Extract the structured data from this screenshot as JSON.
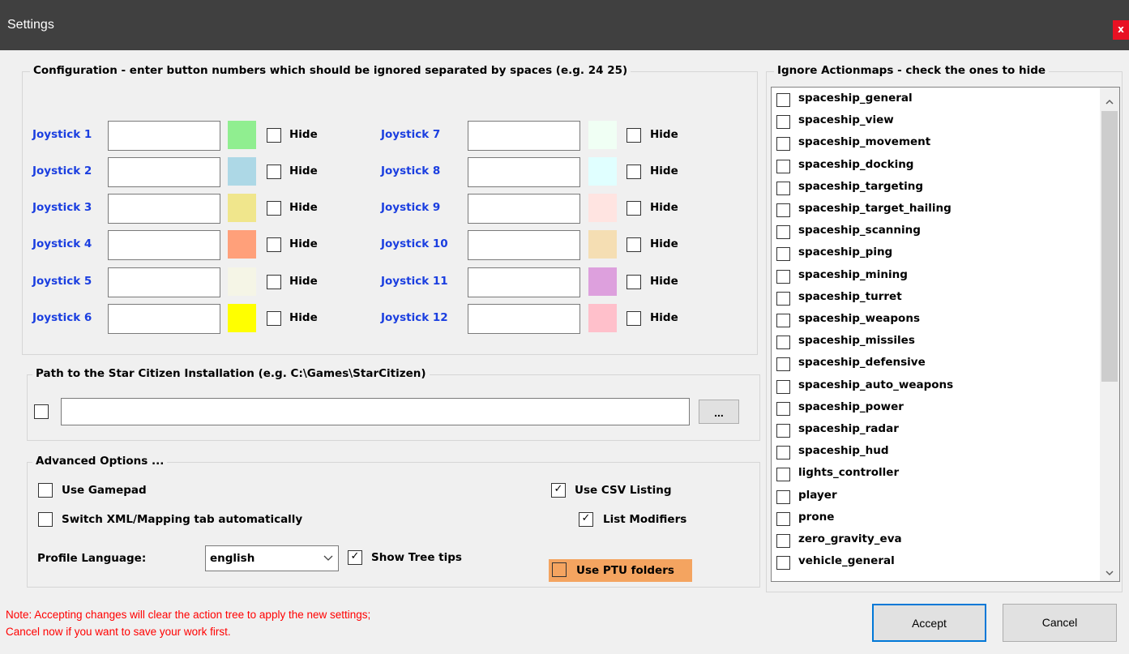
{
  "window": {
    "title": "Settings",
    "close_glyph": "x"
  },
  "config": {
    "legend": "Configuration - enter button numbers which should be ignored separated by spaces (e.g. 24 25)",
    "hide_label": "Hide",
    "joysticks": [
      {
        "label": "Joystick 1",
        "value": "",
        "color": "#90ee90",
        "hide": false
      },
      {
        "label": "Joystick 2",
        "value": "",
        "color": "#add8e6",
        "hide": false
      },
      {
        "label": "Joystick 3",
        "value": "",
        "color": "#f0e68c",
        "hide": false
      },
      {
        "label": "Joystick 4",
        "value": "",
        "color": "#ffa07a",
        "hide": false
      },
      {
        "label": "Joystick 5",
        "value": "",
        "color": "#f5f5e6",
        "hide": false
      },
      {
        "label": "Joystick 6",
        "value": "",
        "color": "#ffff00",
        "hide": false
      },
      {
        "label": "Joystick 7",
        "value": "",
        "color": "#f0fff4",
        "hide": false
      },
      {
        "label": "Joystick 8",
        "value": "",
        "color": "#e0ffff",
        "hide": false
      },
      {
        "label": "Joystick 9",
        "value": "",
        "color": "#ffe4e1",
        "hide": false
      },
      {
        "label": "Joystick 10",
        "value": "",
        "color": "#f5deb3",
        "hide": false
      },
      {
        "label": "Joystick 11",
        "value": "",
        "color": "#dda0dd",
        "hide": false
      },
      {
        "label": "Joystick 12",
        "value": "",
        "color": "#ffc0cb",
        "hide": false
      }
    ]
  },
  "path": {
    "legend": "Path to the Star Citizen Installation (e.g. C:\\Games\\StarCitizen)",
    "value": "",
    "checked": false,
    "browse_label": "..."
  },
  "advanced": {
    "legend": "Advanced Options ...",
    "use_gamepad": "Use Gamepad",
    "switch_xml": "Switch XML/Mapping tab automatically",
    "profile_language_label": "Profile Language:",
    "profile_language_value": "english",
    "show_tree_tips": "Show Tree tips",
    "use_csv": "Use CSV Listing",
    "list_modifiers": "List Modifiers",
    "use_ptu": "Use PTU folders",
    "ptu_highlight": "#f4a460"
  },
  "actionmaps": {
    "legend": "Ignore Actionmaps - check the ones to hide",
    "items": [
      "spaceship_general",
      "spaceship_view",
      "spaceship_movement",
      "spaceship_docking",
      "spaceship_targeting",
      "spaceship_target_hailing",
      "spaceship_scanning",
      "spaceship_ping",
      "spaceship_mining",
      "spaceship_turret",
      "spaceship_weapons",
      "spaceship_missiles",
      "spaceship_defensive",
      "spaceship_auto_weapons",
      "spaceship_power",
      "spaceship_radar",
      "spaceship_hud",
      "lights_controller",
      "player",
      "prone",
      "zero_gravity_eva",
      "vehicle_general"
    ]
  },
  "note": {
    "line1": "Note: Accepting changes will clear the action tree to apply the new settings;",
    "line2": "Cancel now if you want to save your work first."
  },
  "buttons": {
    "accept": "Accept",
    "cancel": "Cancel"
  }
}
